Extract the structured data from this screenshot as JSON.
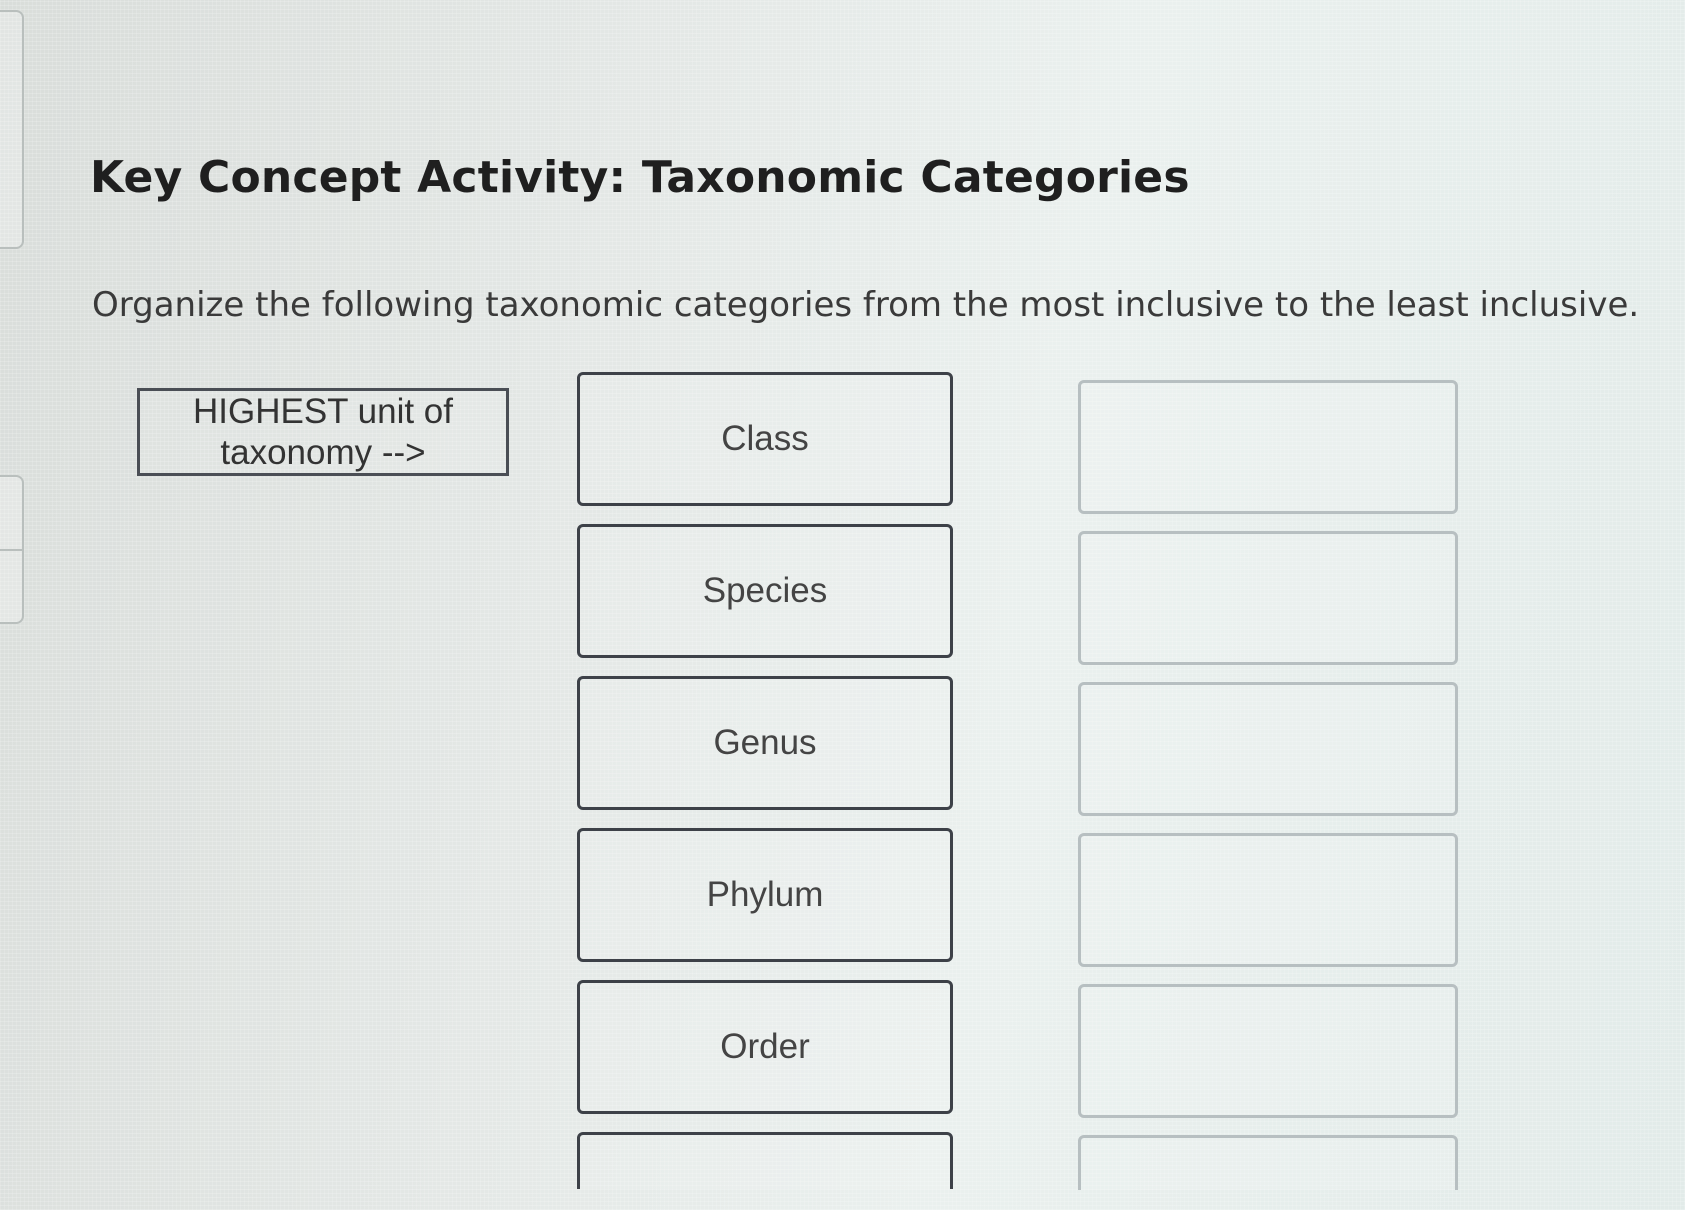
{
  "activity": {
    "title": "Key Concept Activity: Taxonomic Categories",
    "instructions": "Organize the following taxonomic categories from the most inclusive to the least inclusive."
  },
  "label_box": {
    "line1": "HIGHEST unit of",
    "line2": "taxonomy -->"
  },
  "choices": [
    "Class",
    "Species",
    "Genus",
    "Phylum",
    "Order",
    ""
  ],
  "drop_targets": [
    "",
    "",
    "",
    "",
    "",
    ""
  ]
}
